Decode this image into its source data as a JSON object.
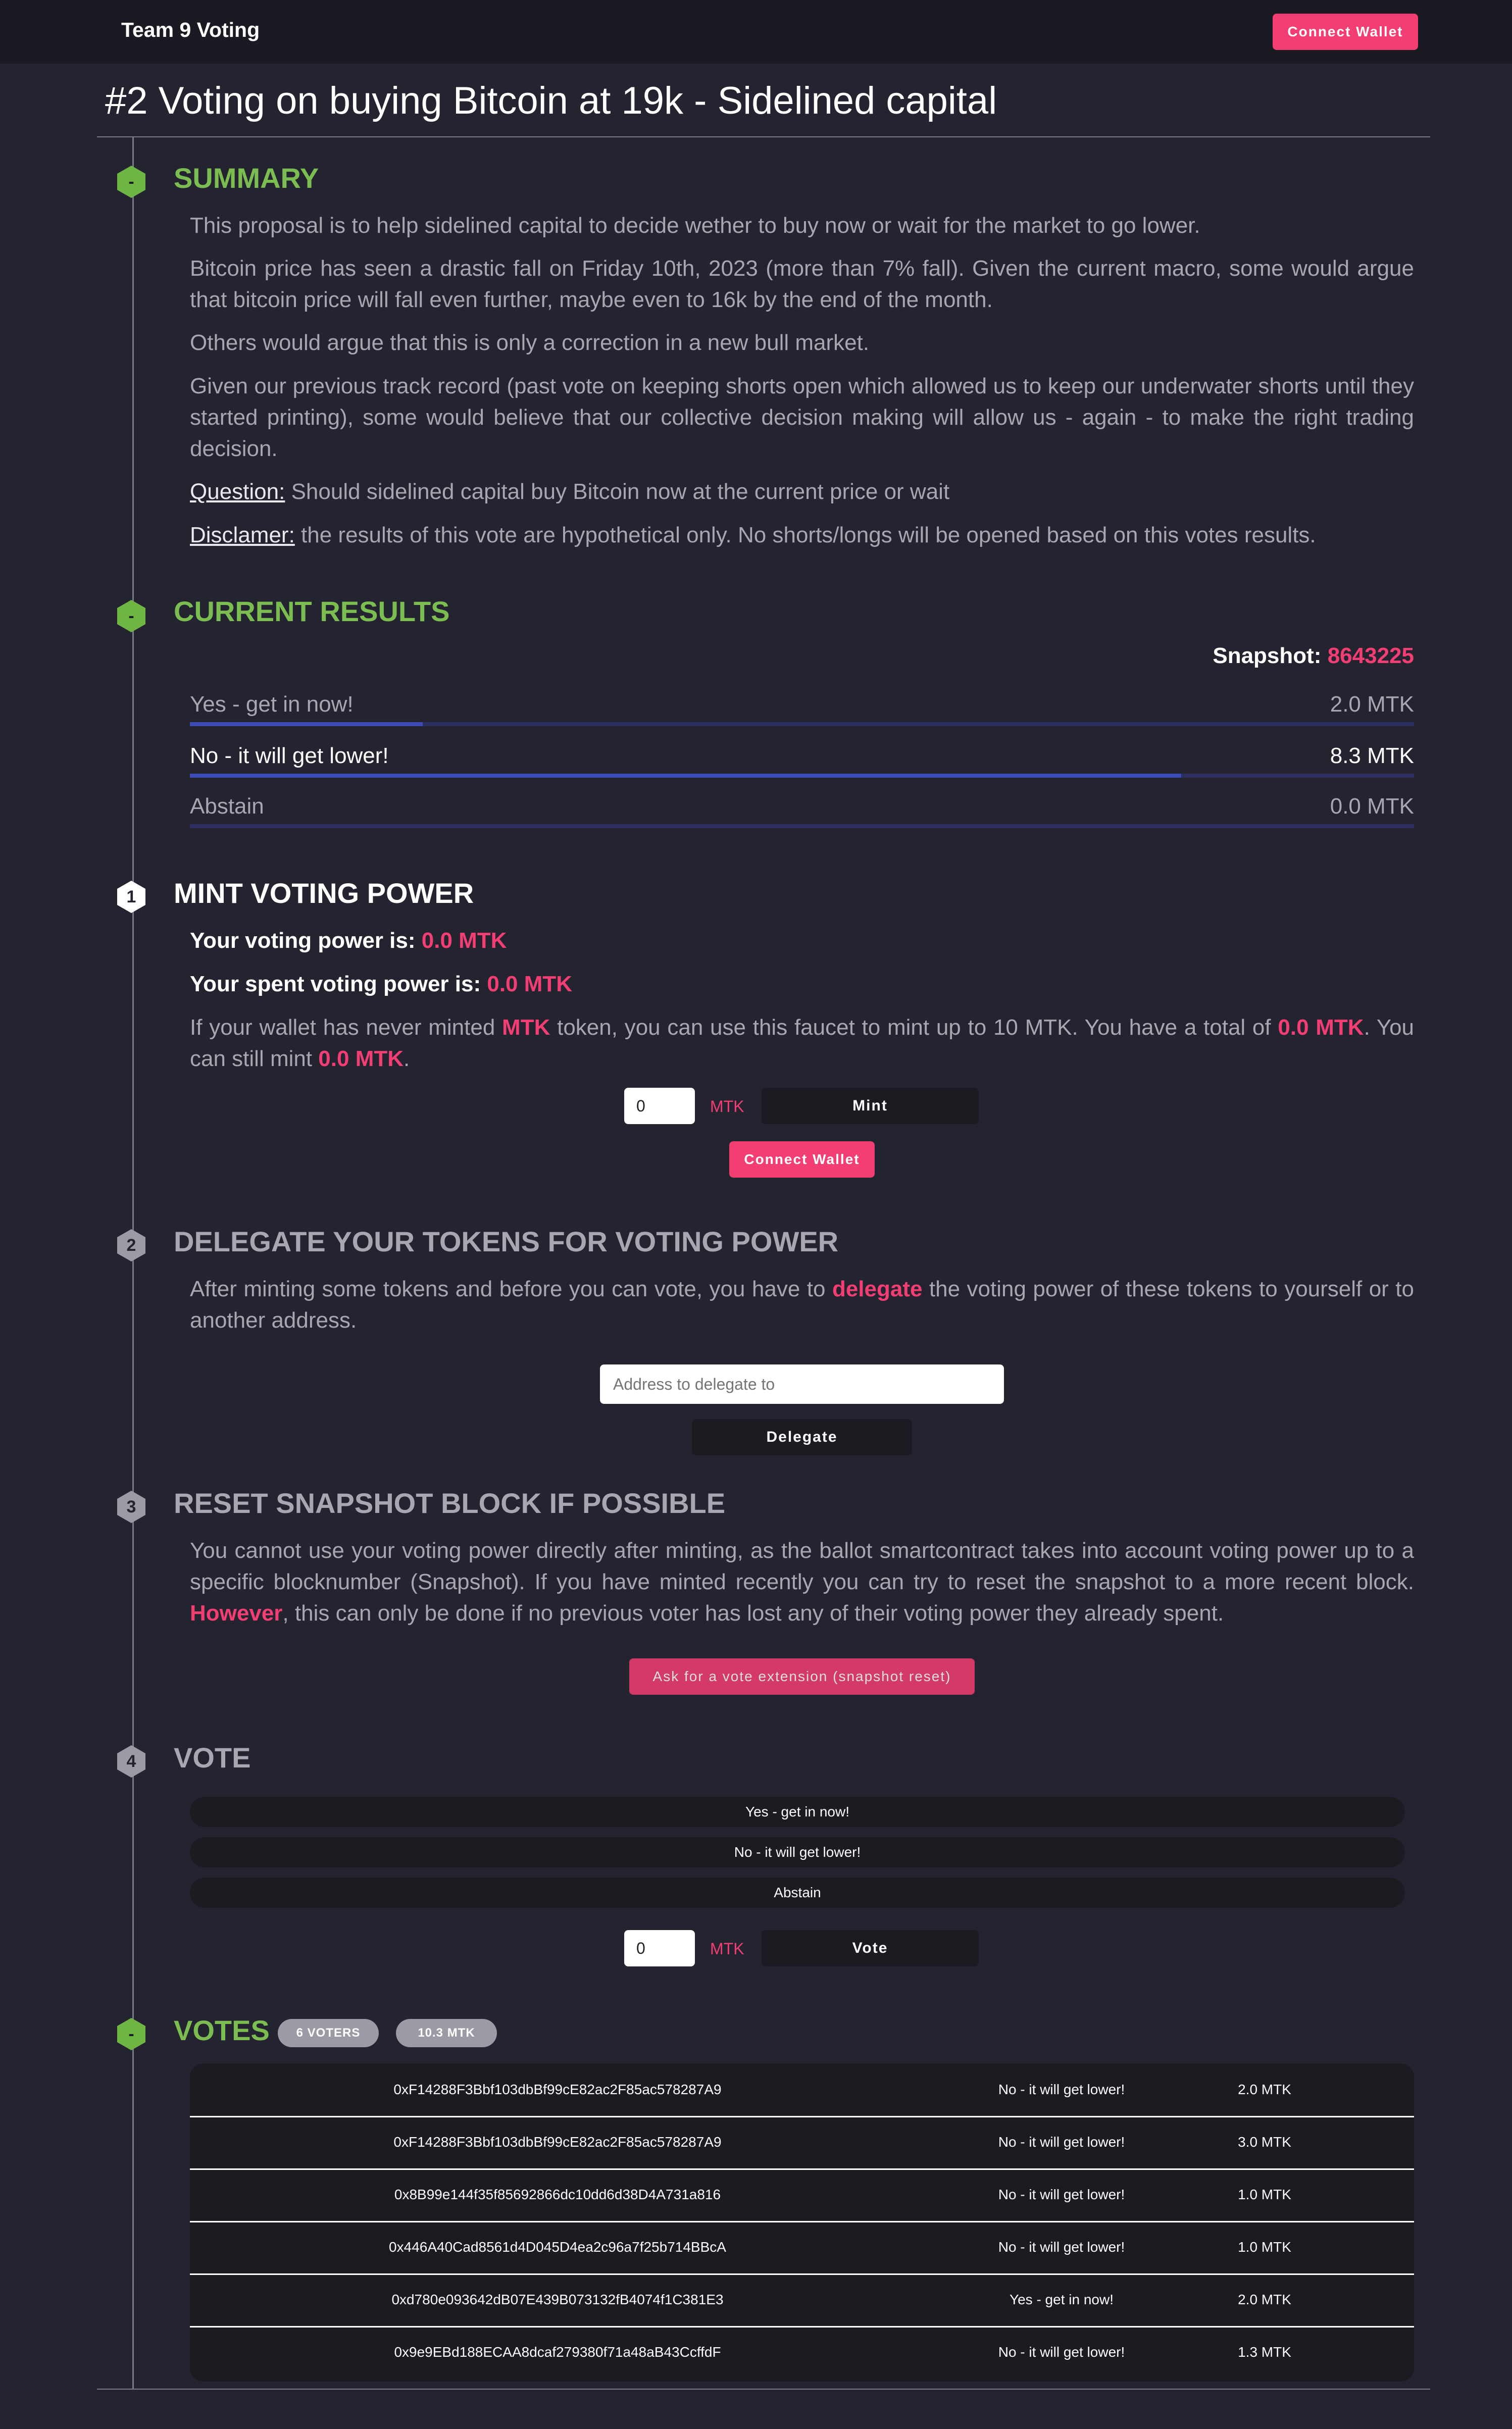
{
  "app": {
    "brand": "Team 9 Voting",
    "connect_label": "Connect Wallet"
  },
  "page": {
    "title": "#2 Voting on buying Bitcoin at 19k - Sidelined capital"
  },
  "summary": {
    "badge": "-",
    "heading": "SUMMARY",
    "p1": "This proposal is to help sidelined capital to decide wether to buy now or wait for the market to go lower.",
    "p2": "Bitcoin price has seen a drastic fall on Friday 10th, 2023 (more than 7% fall). Given the current macro, some would argue that bitcoin price will fall even further, maybe even to 16k by the end of the month.",
    "p3": "Others would argue that this is only a correction in a new bull market.",
    "p4": "Given our previous track record (past vote on keeping shorts open which allowed us to keep our underwater shorts until they started printing), some would believe that our collective decision making will allow us - again - to make the right trading decision.",
    "question_label": "Question:",
    "question_text": " Should sidelined capital buy Bitcoin now at the current price or wait",
    "disclaimer_label": "Disclamer:",
    "disclaimer_text": " the results of this vote are hypothetical only. No shorts/longs will be opened based on this votes results."
  },
  "results": {
    "badge": "-",
    "heading": "CURRENT RESULTS",
    "snapshot_label": "Snapshot:",
    "snapshot_value": "8643225",
    "rows": [
      {
        "label": "Yes - get in now!",
        "value": "2.0 MTK",
        "share": 0.19
      },
      {
        "label": "No - it will get lower!",
        "value": "8.3 MTK",
        "share": 0.81
      },
      {
        "label": "Abstain",
        "value": "0.0 MTK",
        "share": 0.0
      }
    ]
  },
  "mint": {
    "badge": "1",
    "heading": "MINT VOTING POWER",
    "power_label": "Your voting power is:",
    "power_value": "0.0 MTK",
    "spent_label": "Your spent voting power is:",
    "spent_value": "0.0 MTK",
    "desc_1": "If your wallet has never minted ",
    "desc_token": "MTK",
    "desc_2": " token, you can use this faucet to mint up to 10 MTK. You have a total of ",
    "desc_total": "0.0 MTK",
    "desc_3": ". You can still mint ",
    "desc_remaining": "0.0 MTK",
    "desc_4": ".",
    "amount": "0",
    "unit": "MTK",
    "mint_label": "Mint",
    "connect_label": "Connect Wallet"
  },
  "delegate": {
    "badge": "2",
    "heading": "DELEGATE YOUR TOKENS FOR VOTING POWER",
    "desc_1": "After minting some tokens and before you can vote, you have to ",
    "desc_link": "delegate",
    "desc_2": " the voting power of these tokens to yourself or to another address.",
    "placeholder": "Address to delegate to",
    "button_label": "Delegate"
  },
  "reset": {
    "badge": "3",
    "heading": "RESET SNAPSHOT BLOCK IF POSSIBLE",
    "desc_1": "You cannot use your voting power directly after minting, as the ballot smartcontract takes into account voting power up to a specific blocknumber (Snapshot). If you have minted recently you can try to reset the snapshot to a more recent block. ",
    "desc_emph": "However",
    "desc_2": ", this can only be done if no previous voter has lost any of their voting power they already spent.",
    "button_label": "Ask for a vote extension (snapshot reset)"
  },
  "vote": {
    "badge": "4",
    "heading": "VOTE",
    "options": [
      "Yes - get in now!",
      "No - it will get lower!",
      "Abstain"
    ],
    "amount": "0",
    "unit": "MTK",
    "button_label": "Vote"
  },
  "votes": {
    "badge": "-",
    "heading": "VOTES",
    "voters_badge": "6 VOTERS",
    "total_badge": "10.3 MTK",
    "rows": [
      {
        "address": "0xF14288F3Bbf103dbBf99cE82ac2F85ac578287A9",
        "choice": "No - it will get lower!",
        "amount": "2.0 MTK"
      },
      {
        "address": "0xF14288F3Bbf103dbBf99cE82ac2F85ac578287A9",
        "choice": "No - it will get lower!",
        "amount": "3.0 MTK"
      },
      {
        "address": "0x8B99e144f35f85692866dc10dd6d38D4A731a816",
        "choice": "No - it will get lower!",
        "amount": "1.0 MTK"
      },
      {
        "address": "0x446A40Cad8561d4D045D4ea2c96a7f25b714BBcA",
        "choice": "No - it will get lower!",
        "amount": "1.0 MTK"
      },
      {
        "address": "0xd780e093642dB07E439B073132fB4074f1C381E3",
        "choice": "Yes - get in now!",
        "amount": "2.0 MTK"
      },
      {
        "address": "0x9e9EBd188ECAA8dcaf279380f71a48aB43CcffdF",
        "choice": "No - it will get lower!",
        "amount": "1.3 MTK"
      }
    ]
  },
  "colors": {
    "accent": "#f23e72",
    "success": "#7cbd52",
    "bar": "#3d4bb7",
    "background": "#242431"
  }
}
